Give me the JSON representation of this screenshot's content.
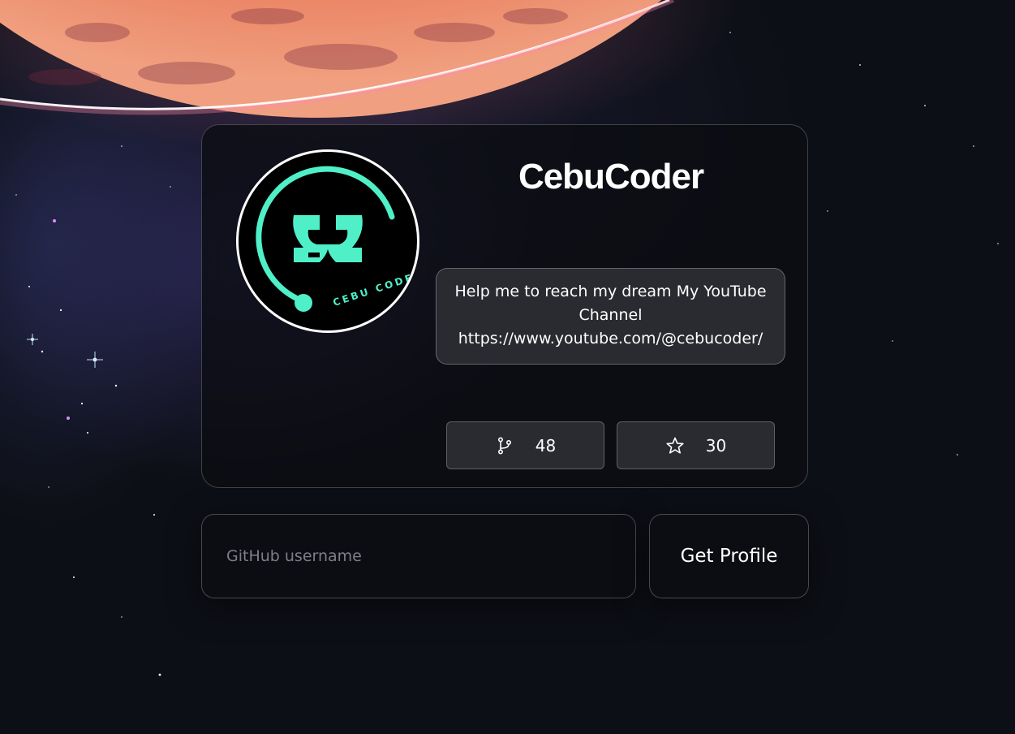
{
  "profile": {
    "username": "CebuCoder",
    "bio": "Help me to reach my dream My YouTube Channel https://www.youtube.com/@cebucoder/",
    "avatar_text": "CEBU CODER",
    "forks": "48",
    "stars": "30"
  },
  "icons": {
    "forks": "git-fork-icon",
    "stars": "star-icon"
  },
  "search": {
    "placeholder": "GitHub username",
    "value": "",
    "button_label": "Get Profile"
  },
  "colors": {
    "accent": "#4ff0c8",
    "planet": "#e3735e",
    "card_bg": "#0c0d12",
    "panel_bg": "#2a2b30"
  }
}
